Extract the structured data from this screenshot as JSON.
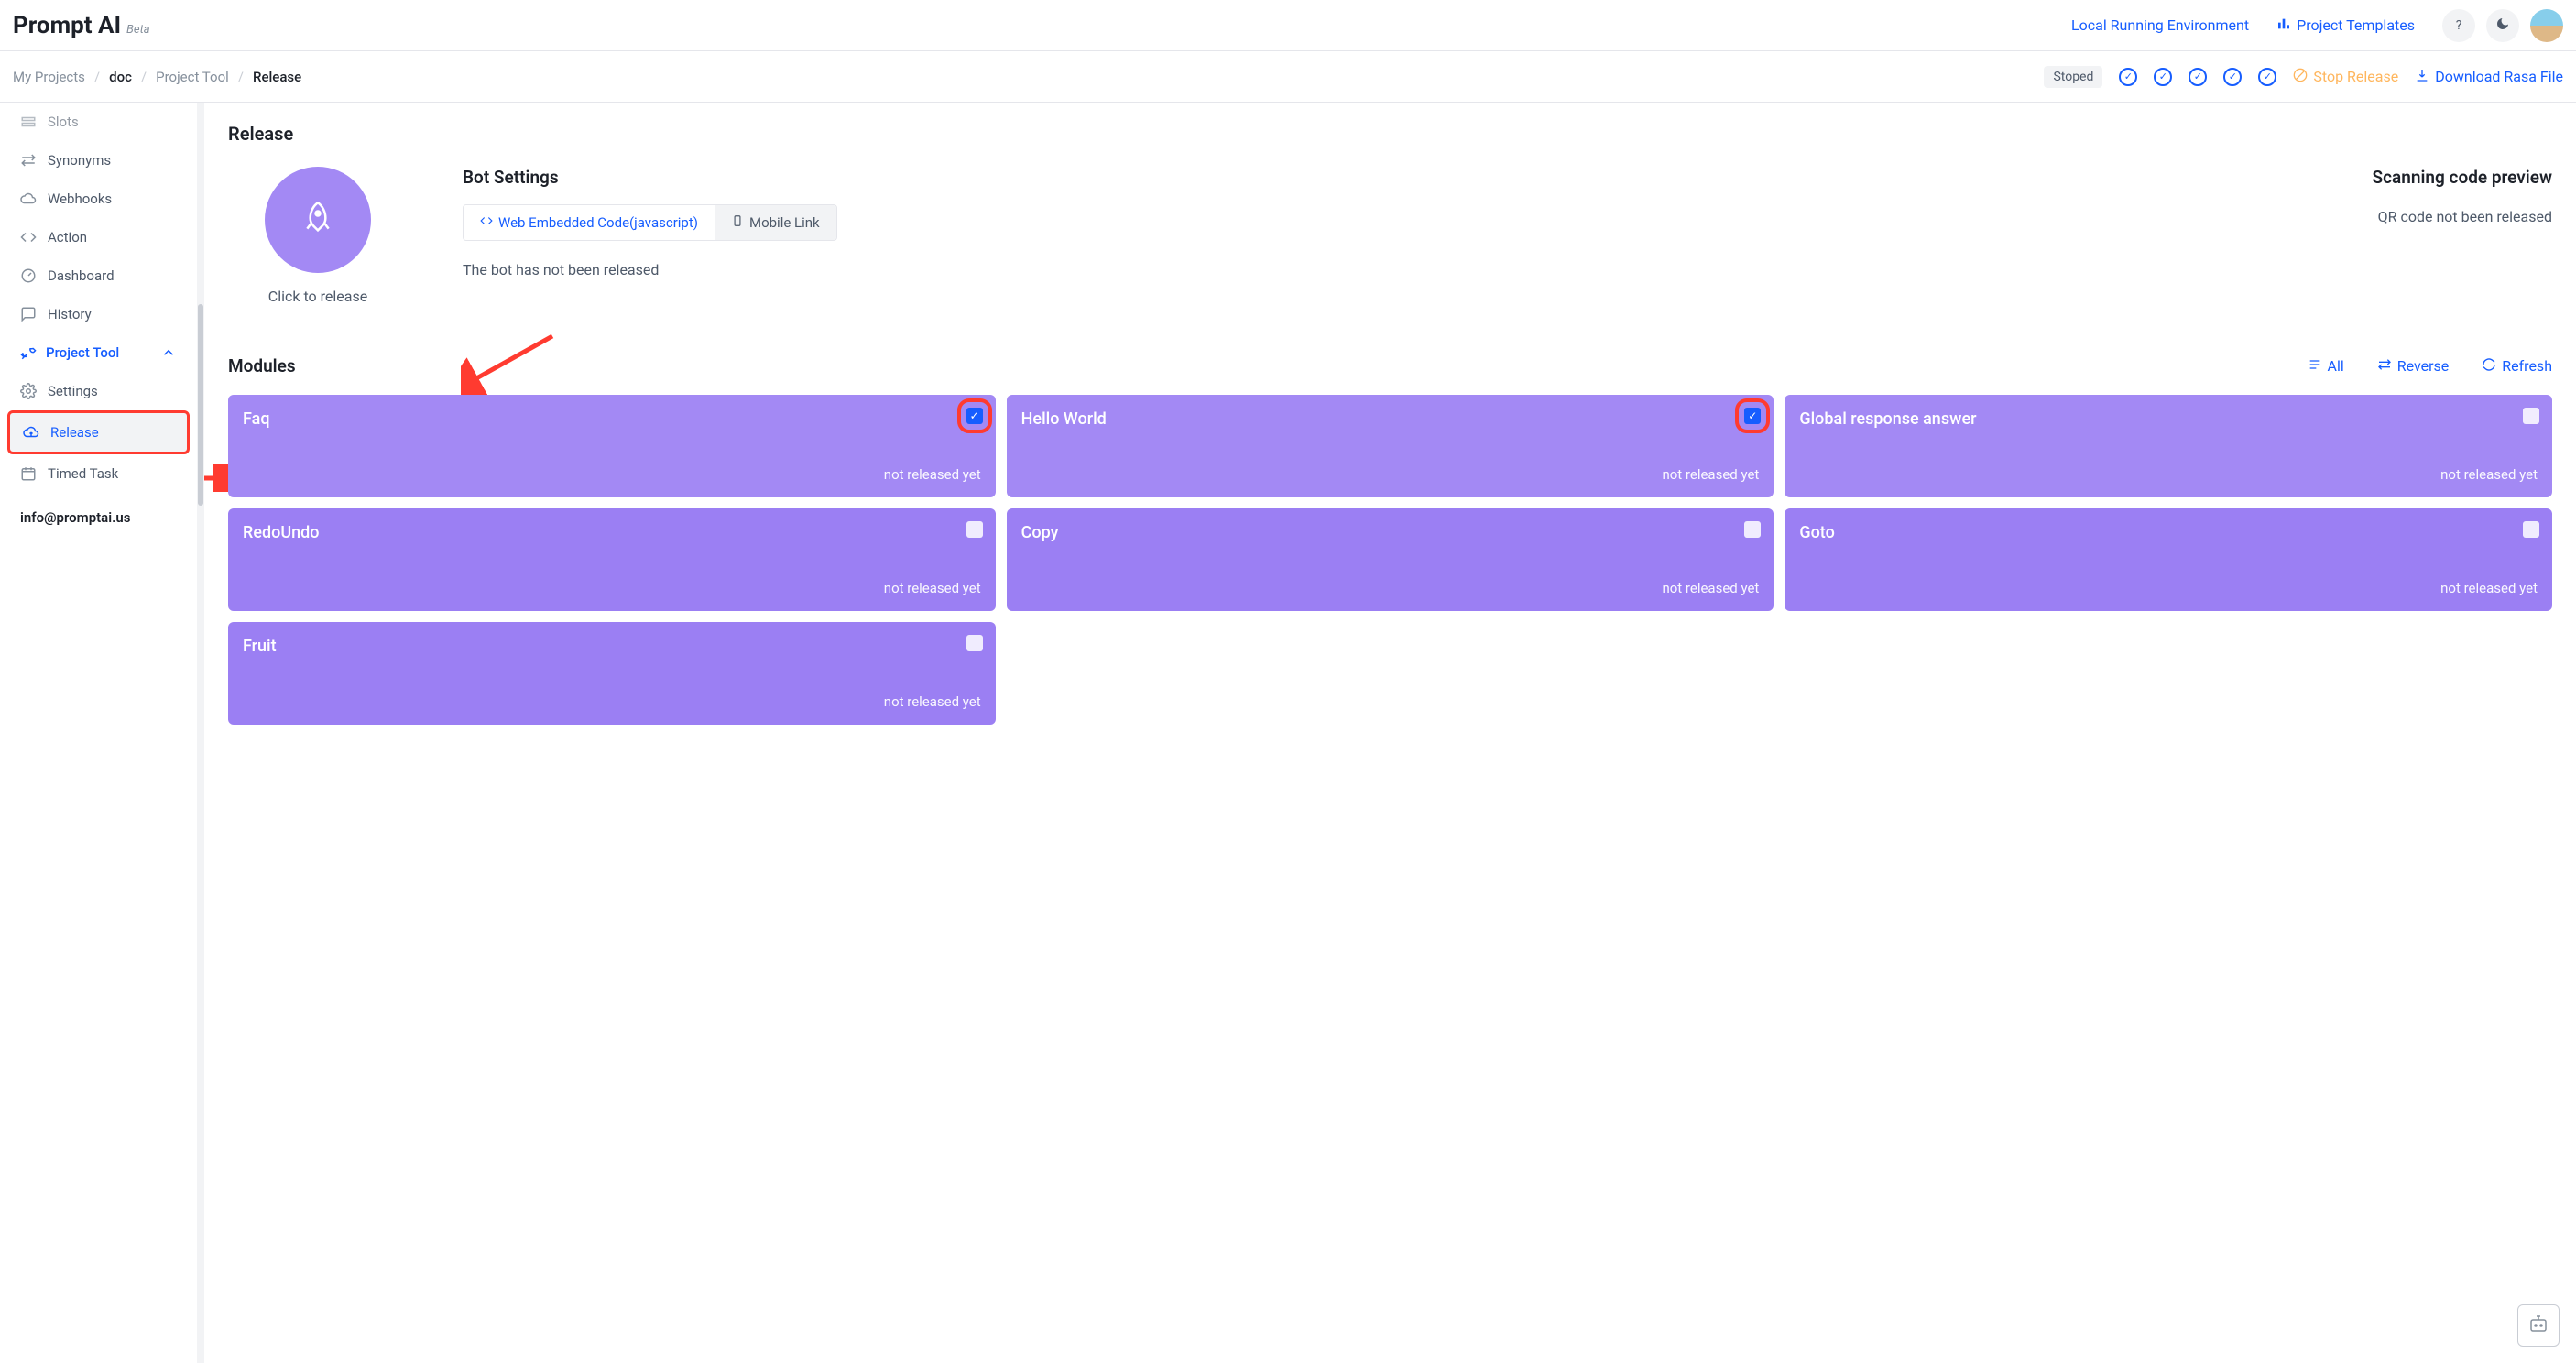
{
  "header": {
    "brand": "Prompt AI",
    "beta": "Beta",
    "local_env": "Local Running Environment",
    "templates": "Project Templates"
  },
  "breadcrumb": {
    "root": "My Projects",
    "project": "doc",
    "section": "Project Tool",
    "page": "Release"
  },
  "subheader": {
    "status": "Stoped",
    "stop_release": "Stop Release",
    "download": "Download Rasa File"
  },
  "sidebar": {
    "items": [
      {
        "label": "Slots",
        "icon": "slots"
      },
      {
        "label": "Synonyms",
        "icon": "swap"
      },
      {
        "label": "Webhooks",
        "icon": "cloud"
      },
      {
        "label": "Action",
        "icon": "code"
      },
      {
        "label": "Dashboard",
        "icon": "dashboard"
      },
      {
        "label": "History",
        "icon": "chat"
      }
    ],
    "group": "Project Tool",
    "sub": [
      {
        "label": "Settings",
        "icon": "gear",
        "active": false
      },
      {
        "label": "Release",
        "icon": "cloud-up",
        "active": true,
        "highlight": true
      },
      {
        "label": "Timed Task",
        "icon": "calendar",
        "active": false
      }
    ],
    "email": "info@promptai.us"
  },
  "release": {
    "title": "Release",
    "click_caption": "Click to release",
    "bot_settings_title": "Bot Settings",
    "tab_web": "Web Embedded Code(javascript)",
    "tab_mobile": "Mobile Link",
    "bot_msg": "The bot has not been released",
    "qr_title": "Scanning code preview",
    "qr_msg": "QR code not been released"
  },
  "modules": {
    "title": "Modules",
    "actions": {
      "all": "All",
      "reverse": "Reverse",
      "refresh": "Refresh"
    },
    "cards": [
      {
        "name": "Faq",
        "status": "not released yet",
        "checked": true,
        "highlight": true
      },
      {
        "name": "Hello World",
        "status": "not released yet",
        "checked": true,
        "highlight": true
      },
      {
        "name": "Global response answer",
        "status": "not released yet",
        "checked": false
      },
      {
        "name": "RedoUndo",
        "status": "not released yet",
        "checked": false
      },
      {
        "name": "Copy",
        "status": "not released yet",
        "checked": false
      },
      {
        "name": "Goto",
        "status": "not released yet",
        "checked": false
      },
      {
        "name": "Fruit",
        "status": "not released yet",
        "checked": false
      }
    ]
  }
}
